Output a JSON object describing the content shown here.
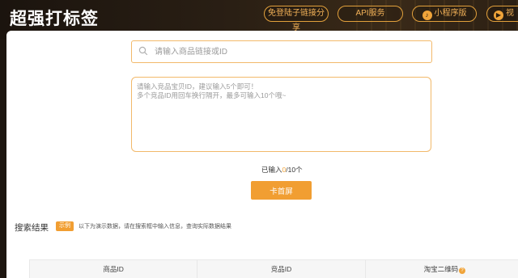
{
  "header": {
    "title": "超强打标签",
    "buttons": {
      "share": "免登陆子链接分享",
      "api": "API服务",
      "mini": "小程序版",
      "video": "视"
    },
    "icons": {
      "mini": "mini-program-icon",
      "video": "video-icon"
    }
  },
  "search": {
    "placeholder": "请输入商品链接或ID",
    "value": ""
  },
  "ids_input": {
    "placeholder": "请输入竞品宝贝ID，建议输入5个即可！\n多个竞品ID用回车换行隔开，最多可输入10个哦~",
    "value": ""
  },
  "count": {
    "prefix": "已输入",
    "current": "0",
    "suffix": "/10个"
  },
  "submit_label": "卡首屏",
  "results": {
    "title": "搜索结果",
    "badge": "示例",
    "note": "以下为演示数据，请在搜索框中输入信息，查询实际数据结果"
  },
  "table": {
    "columns": [
      "商品ID",
      "竞品ID",
      "淘宝二维码"
    ]
  },
  "colors": {
    "accent": "#f19e32",
    "border": "#f2b96a",
    "header_bg": "#1d1610"
  }
}
